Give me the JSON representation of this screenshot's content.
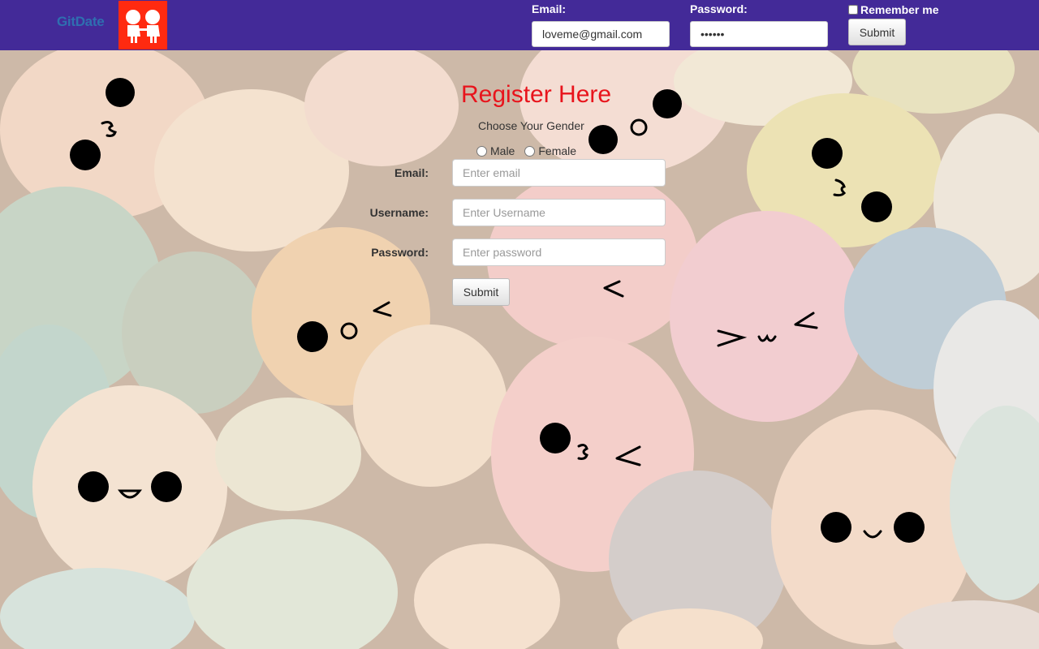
{
  "nav": {
    "brand": "GitDate",
    "email_label": "Email:",
    "email_value": "loveme@gmail.com",
    "password_label": "Password:",
    "password_value": "secret",
    "remember_label": "Remember me",
    "submit_label": "Submit"
  },
  "register": {
    "title": "Register Here",
    "gender_prompt": "Choose Your Gender",
    "gender_options": [
      "Male",
      "Female"
    ],
    "email_label": "Email:",
    "email_placeholder": "Enter email",
    "username_label": "Username:",
    "username_placeholder": "Enter Username",
    "password_label": "Password:",
    "password_placeholder": "Enter password",
    "submit_label": "Submit"
  },
  "colors": {
    "navbar": "#432a98",
    "brand_text": "#2f6fb0",
    "logo_bg": "#ff2a10",
    "title": "#e8141c"
  },
  "icons": {
    "logo": "couple-icon"
  }
}
